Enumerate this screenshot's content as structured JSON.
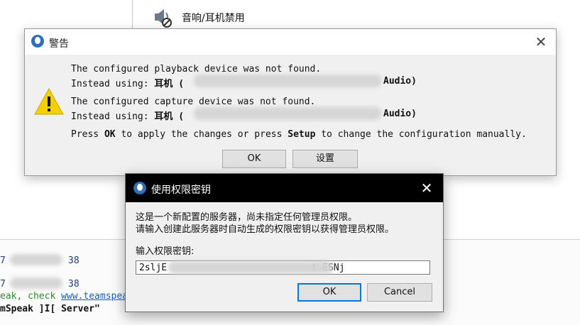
{
  "background": {
    "tree_item_label": "音响/耳机禁用",
    "log": {
      "line1_suffix": "38",
      "line1_prefix": "7",
      "line2_suffix": "38",
      "line2_prefix": "7",
      "line3_text": "eak, check ",
      "line3_link": "www.teamspea",
      "line4_text": "mSpeak ]I[ Server\""
    }
  },
  "warning_dialog": {
    "title": "警告",
    "close_glyph": "✕",
    "playback_line": "The configured playback device was not found.",
    "playback_using_prefix": "Instead using: ",
    "playback_device_start": "耳机 (",
    "playback_device_end": "Audio)",
    "capture_line": "The configured capture device was not found.",
    "capture_using_prefix": "Instead using: ",
    "capture_device_start": "耳机 (",
    "capture_device_end": "Audio)",
    "instruction_pre": "Press ",
    "instruction_ok": "OK",
    "instruction_mid": " to apply the changes or press ",
    "instruction_setup": "Setup",
    "instruction_post": " to change the configuration manually.",
    "ok_label": "OK",
    "setup_label": "设置"
  },
  "key_dialog": {
    "title": "使用权限密钥",
    "close_glyph": "✕",
    "message_line1": "这是一个新配置的服务器，尚未指定任何管理员权限。",
    "message_line2": "请输入创建此服务器时自动生成的权限密钥以获得管理员权限。",
    "field_label": "输入权限密钥:",
    "key_value": "2sljE                          t ESNj",
    "ok_label": "OK",
    "cancel_label": "Cancel"
  },
  "colors": {
    "link": "#1a5fb4",
    "log_blue": "#1f3f80",
    "log_green": "#2b8a2b",
    "warning_yellow": "#f5d000",
    "primary_border": "#0078d7"
  }
}
